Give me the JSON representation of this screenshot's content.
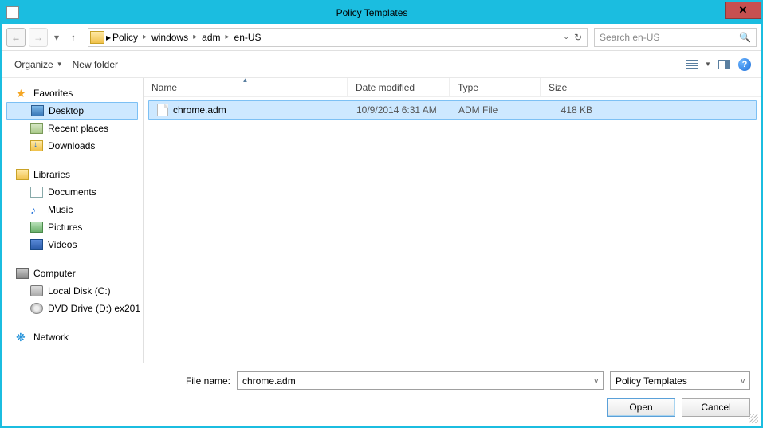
{
  "title": "Policy Templates",
  "breadcrumb": [
    "Policy",
    "windows",
    "adm",
    "en-US"
  ],
  "search": {
    "placeholder": "Search en-US"
  },
  "toolbar": {
    "organize": "Organize",
    "newfolder": "New folder"
  },
  "nav": {
    "favorites": {
      "label": "Favorites",
      "items": [
        "Desktop",
        "Recent places",
        "Downloads"
      ]
    },
    "libraries": {
      "label": "Libraries",
      "items": [
        "Documents",
        "Music",
        "Pictures",
        "Videos"
      ]
    },
    "computer": {
      "label": "Computer",
      "items": [
        "Local Disk (C:)",
        "DVD Drive (D:) ex201"
      ]
    },
    "network": {
      "label": "Network"
    }
  },
  "columns": {
    "name": "Name",
    "date": "Date modified",
    "type": "Type",
    "size": "Size"
  },
  "files": [
    {
      "name": "chrome.adm",
      "date": "10/9/2014 6:31 AM",
      "type": "ADM File",
      "size": "418 KB"
    }
  ],
  "footer": {
    "filenameLabel": "File name:",
    "filenameValue": "chrome.adm",
    "filterValue": "Policy Templates",
    "open": "Open",
    "cancel": "Cancel"
  }
}
